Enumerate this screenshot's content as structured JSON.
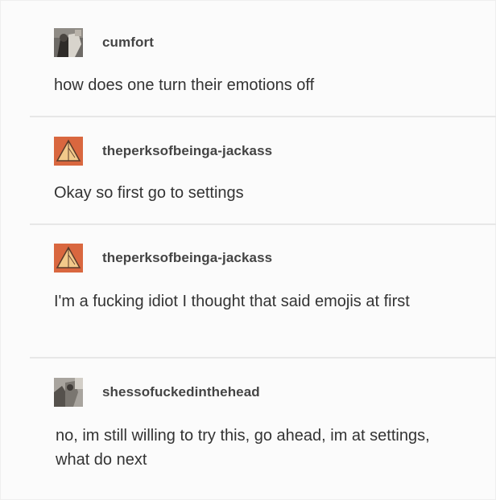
{
  "posts": [
    {
      "username": "cumfort",
      "avatar": "photo-avatar-dark",
      "text": "how does one turn their emotions off"
    },
    {
      "username": "theperksofbeinga-jackass",
      "avatar": "orange-triangle-avatar",
      "text": "Okay so first go to settings"
    },
    {
      "username": "theperksofbeinga-jackass",
      "avatar": "orange-triangle-avatar",
      "text": "I'm a fucking idiot I thought that said emojis at first"
    },
    {
      "username": "shessofuckedinthehead",
      "avatar": "photo-avatar-grey",
      "text": "no, im still willing to try this, go ahead, im at settings, what do next"
    }
  ],
  "colors": {
    "avatar_orange": "#d9673f",
    "avatar_triangle": "#f2c98a"
  }
}
